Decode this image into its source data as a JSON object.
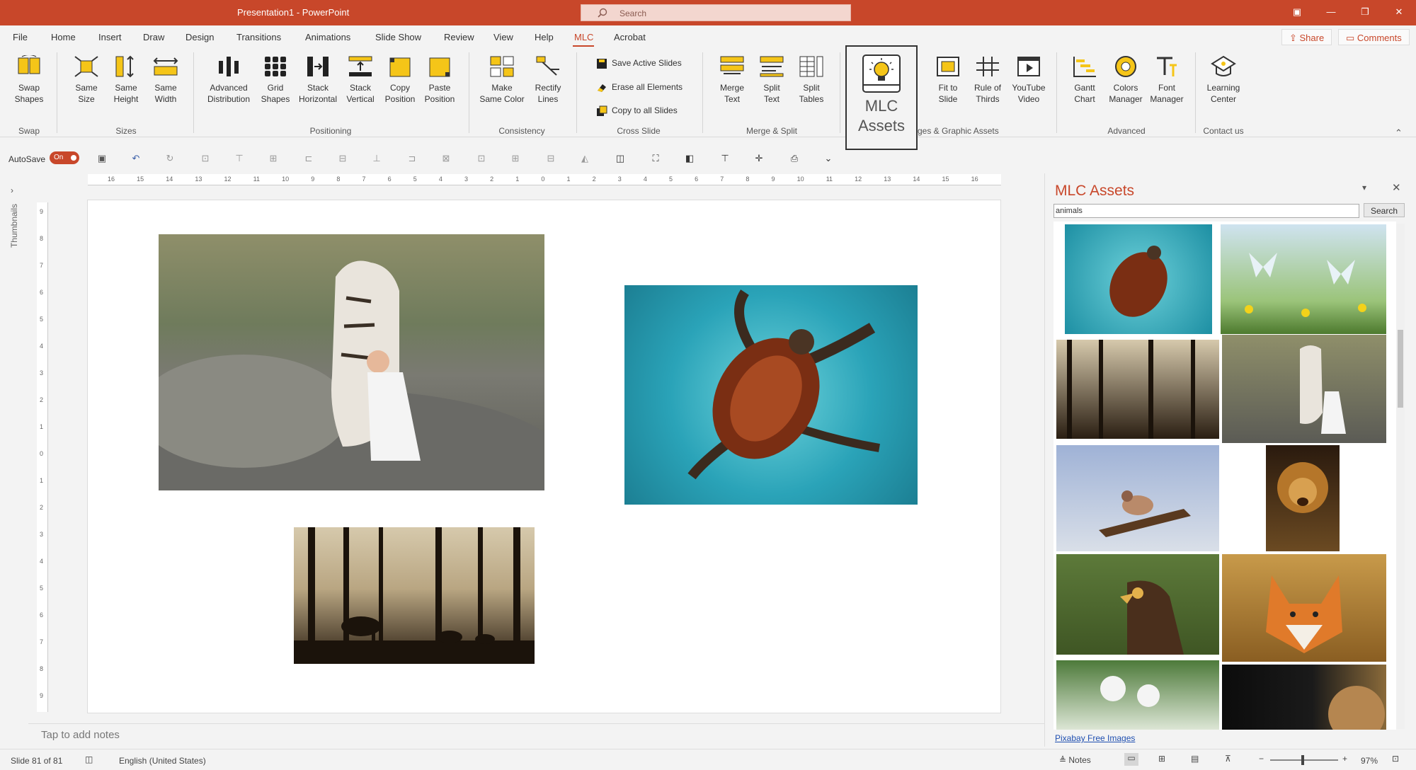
{
  "titlebar": {
    "title": "Presentation1 - PowerPoint",
    "search_placeholder": "Search"
  },
  "menu": [
    "File",
    "Home",
    "Insert",
    "Draw",
    "Design",
    "Transitions",
    "Animations",
    "Slide Show",
    "Review",
    "View",
    "Help",
    "MLC",
    "Acrobat"
  ],
  "active_menu": "MLC",
  "share_label": "Share",
  "comments_label": "Comments",
  "ribbon": {
    "swap_shapes": [
      "Swap",
      "Shapes"
    ],
    "same_size": [
      "Same",
      "Size"
    ],
    "same_height": [
      "Same",
      "Height"
    ],
    "same_width": [
      "Same",
      "Width"
    ],
    "advanced_distribution": [
      "Advanced",
      "Distribution"
    ],
    "grid_shapes": [
      "Grid",
      "Shapes"
    ],
    "stack_horizontal": [
      "Stack",
      "Horizontal"
    ],
    "stack_vertical": [
      "Stack",
      "Vertical"
    ],
    "copy_position": [
      "Copy",
      "Position"
    ],
    "paste_position": [
      "Paste",
      "Position"
    ],
    "make_same_color": [
      "Make",
      "Same Color"
    ],
    "rectify_lines": [
      "Rectify",
      "Lines"
    ],
    "save_active_slides": "Save Active Slides",
    "erase_all_elements": "Erase all Elements",
    "copy_to_all_slides": "Copy to all Slides",
    "merge_text": [
      "Merge",
      "Text"
    ],
    "split_text": [
      "Split",
      "Text"
    ],
    "split_tables": [
      "Split",
      "Tables"
    ],
    "mlc_assets": [
      "MLC",
      "Assets"
    ],
    "fit_to_slide": [
      "Fit to",
      "Slide"
    ],
    "rule_of_thirds": [
      "Rule of",
      "Thirds"
    ],
    "youtube_video": [
      "YouTube",
      "Video"
    ],
    "gantt_chart": [
      "Gantt",
      "Chart"
    ],
    "colors_manager": [
      "Colors",
      "Manager"
    ],
    "font_manager": [
      "Font",
      "Manager"
    ],
    "learning_center": [
      "Learning",
      "Center"
    ],
    "groups": {
      "swap": "Swap",
      "sizes": "Sizes",
      "positioning": "Positioning",
      "consistency": "Consistency",
      "cross_slide": "Cross Slide",
      "merge_split": "Merge & Split",
      "images": "ges & Graphic Assets",
      "advanced": "Advanced",
      "contact": "Contact us"
    }
  },
  "qat": {
    "autosave": "AutoSave",
    "toggle": "On"
  },
  "thumbnails_label": "Thumbnails",
  "ruler_labels": [
    "16",
    "15",
    "14",
    "13",
    "12",
    "11",
    "10",
    "9",
    "8",
    "7",
    "6",
    "5",
    "4",
    "3",
    "2",
    "1",
    "0",
    "1",
    "2",
    "3",
    "4",
    "5",
    "6",
    "7",
    "8",
    "9",
    "10",
    "11",
    "12",
    "13",
    "14",
    "15",
    "16"
  ],
  "notes_placeholder": "Tap to add notes",
  "panel": {
    "title": "MLC Assets",
    "search_value": "animals",
    "search_button": "Search",
    "link": "Pixabay Free Images"
  },
  "status": {
    "slide": "Slide 81 of 81",
    "language": "English (United States)",
    "notes": "Notes",
    "zoom": "97%"
  },
  "colors": {
    "accent": "#c8472a"
  }
}
